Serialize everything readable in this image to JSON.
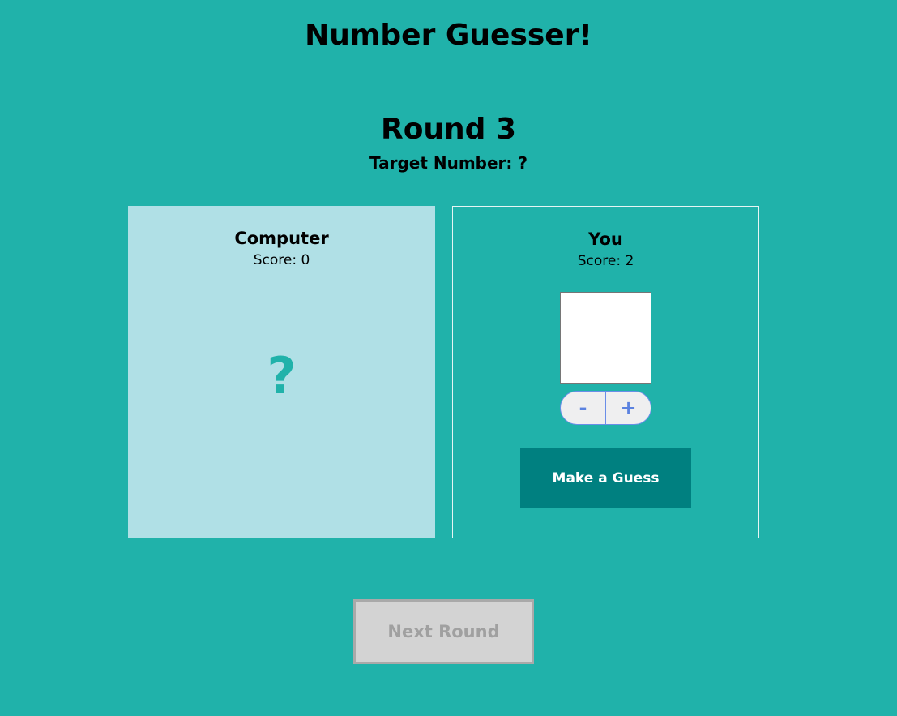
{
  "app": {
    "title": "Number Guesser!"
  },
  "round": {
    "title": "Round 3",
    "target_line": "Target Number: ?"
  },
  "computer_panel": {
    "name": "Computer",
    "score_text": "Score: 0",
    "guess_display": "?"
  },
  "player_panel": {
    "name": "You",
    "score_text": "Score: 2",
    "guess_value": "",
    "decrement_label": "-",
    "increment_label": "+",
    "guess_button_label": "Make a Guess"
  },
  "next_button": {
    "label": "Next Round",
    "state": "disabled"
  },
  "colors": {
    "background": "#20b2aa",
    "computer_panel_bg": "#b0e0e6",
    "guess_button_bg": "#008080",
    "stepper_accent": "#5b82e0",
    "next_button_bg": "#d3d3d3"
  }
}
